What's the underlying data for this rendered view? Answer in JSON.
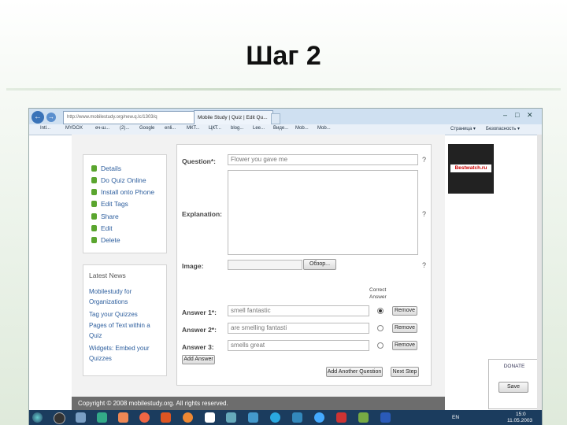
{
  "slide": {
    "title": "Шаг 2"
  },
  "browser": {
    "url": "http://www.mobilestudy.org/new.q.lc/1303/q",
    "tab_label": "Mobile Study | Quiz | Edit Qu...",
    "window_controls": [
      "–",
      "□",
      "✕"
    ],
    "favorites": [
      "Intl...",
      "MYDOX",
      "еч-ш...",
      "(2)...",
      "Google",
      "enli...",
      "МКТ...",
      "ЦКТ...",
      "blog...",
      "Lee...",
      "Виде...",
      "Mob...",
      "Mob..."
    ],
    "right_toolbar": [
      "Страница ▾",
      "Безопасность ▾"
    ]
  },
  "sidebar": {
    "menu": [
      {
        "label": "Details"
      },
      {
        "label": "Do Quiz Online"
      },
      {
        "label": "Install onto Phone"
      },
      {
        "label": "Edit Tags"
      },
      {
        "label": "Share"
      },
      {
        "label": "Edit"
      },
      {
        "label": "Delete"
      }
    ],
    "news_title": "Latest News",
    "news": [
      {
        "label": "Mobilestudy for Organizations"
      },
      {
        "label": "Tag your Quizzes"
      },
      {
        "label": "Pages of Text within a Quiz"
      },
      {
        "label": "Widgets: Embed your Quizzes"
      }
    ]
  },
  "form": {
    "question_label": "Question*:",
    "question_value": "Flower you gave me",
    "explanation_label": "Explanation:",
    "image_label": "Image:",
    "browse_label": "Обзор...",
    "correct_answer_label": "Correct Answer",
    "help_mark": "?",
    "answers": [
      {
        "label": "Answer 1*:",
        "value": "smell fantastic",
        "remove": "Remove"
      },
      {
        "label": "Answer 2*:",
        "value": "are smelling fantasti",
        "remove": "Remove"
      },
      {
        "label": "Answer 3:",
        "value": "smells great",
        "remove": "Remove"
      }
    ],
    "correct_index": 0,
    "add_answer": "Add Answer",
    "add_another_question": "Add Another Question",
    "next_step": "Next Step"
  },
  "ad": {
    "logo": "Bestwatch.ru"
  },
  "donate": {
    "label": "DONATE",
    "button": "Save"
  },
  "footer": {
    "text": "Copyright © 2008 mobilestudy.org. All rights reserved."
  },
  "taskbar": {
    "lang": "EN",
    "time": "15:0",
    "date": "11.05.2003"
  },
  "colors": {
    "accent": "#2e5f9e",
    "menu_dot": "#5aa52e",
    "taskbar": "#1b3c5e"
  }
}
